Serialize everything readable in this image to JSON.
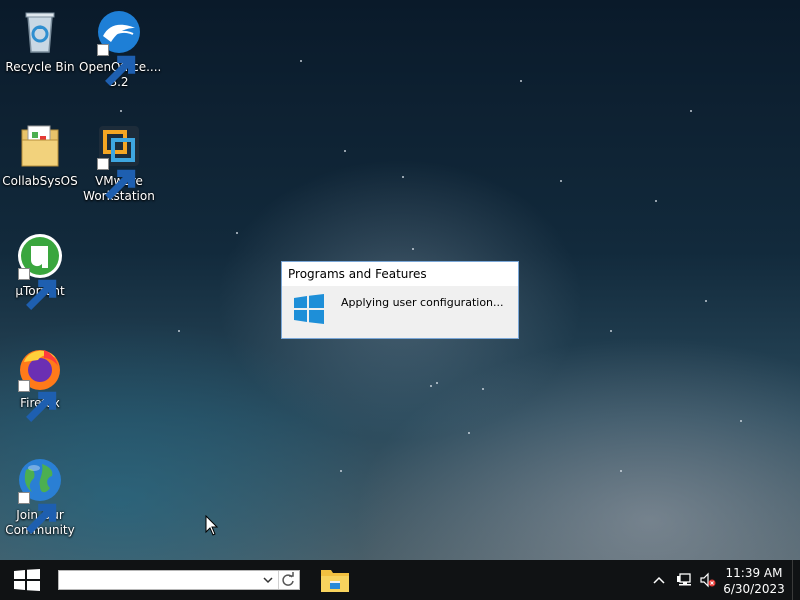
{
  "desktop": {
    "icons": [
      {
        "label": "Recycle Bin",
        "icon": "recycle-bin-icon"
      },
      {
        "label": "OpenOffice....\n3.2",
        "icon": "openoffice-icon"
      },
      {
        "label": "CollabSysOS",
        "icon": "folder-icon"
      },
      {
        "label": "VMware\nWorkstation",
        "icon": "vmware-icon"
      },
      {
        "label": "µTorrent",
        "icon": "utorrent-icon"
      },
      {
        "label": "Firefox",
        "icon": "firefox-icon"
      },
      {
        "label": "Join Our\nCommunity",
        "icon": "globe-icon"
      }
    ]
  },
  "dialog": {
    "title": "Programs and Features",
    "message": "Applying user configuration..."
  },
  "taskbar": {
    "search_value": "",
    "clock_time": "11:39 AM",
    "clock_date": "6/30/2023"
  },
  "colors": {
    "taskbar_bg": "#101214",
    "windows_blue": "#1e8fd8",
    "dialog_border": "#7aa7d8"
  }
}
